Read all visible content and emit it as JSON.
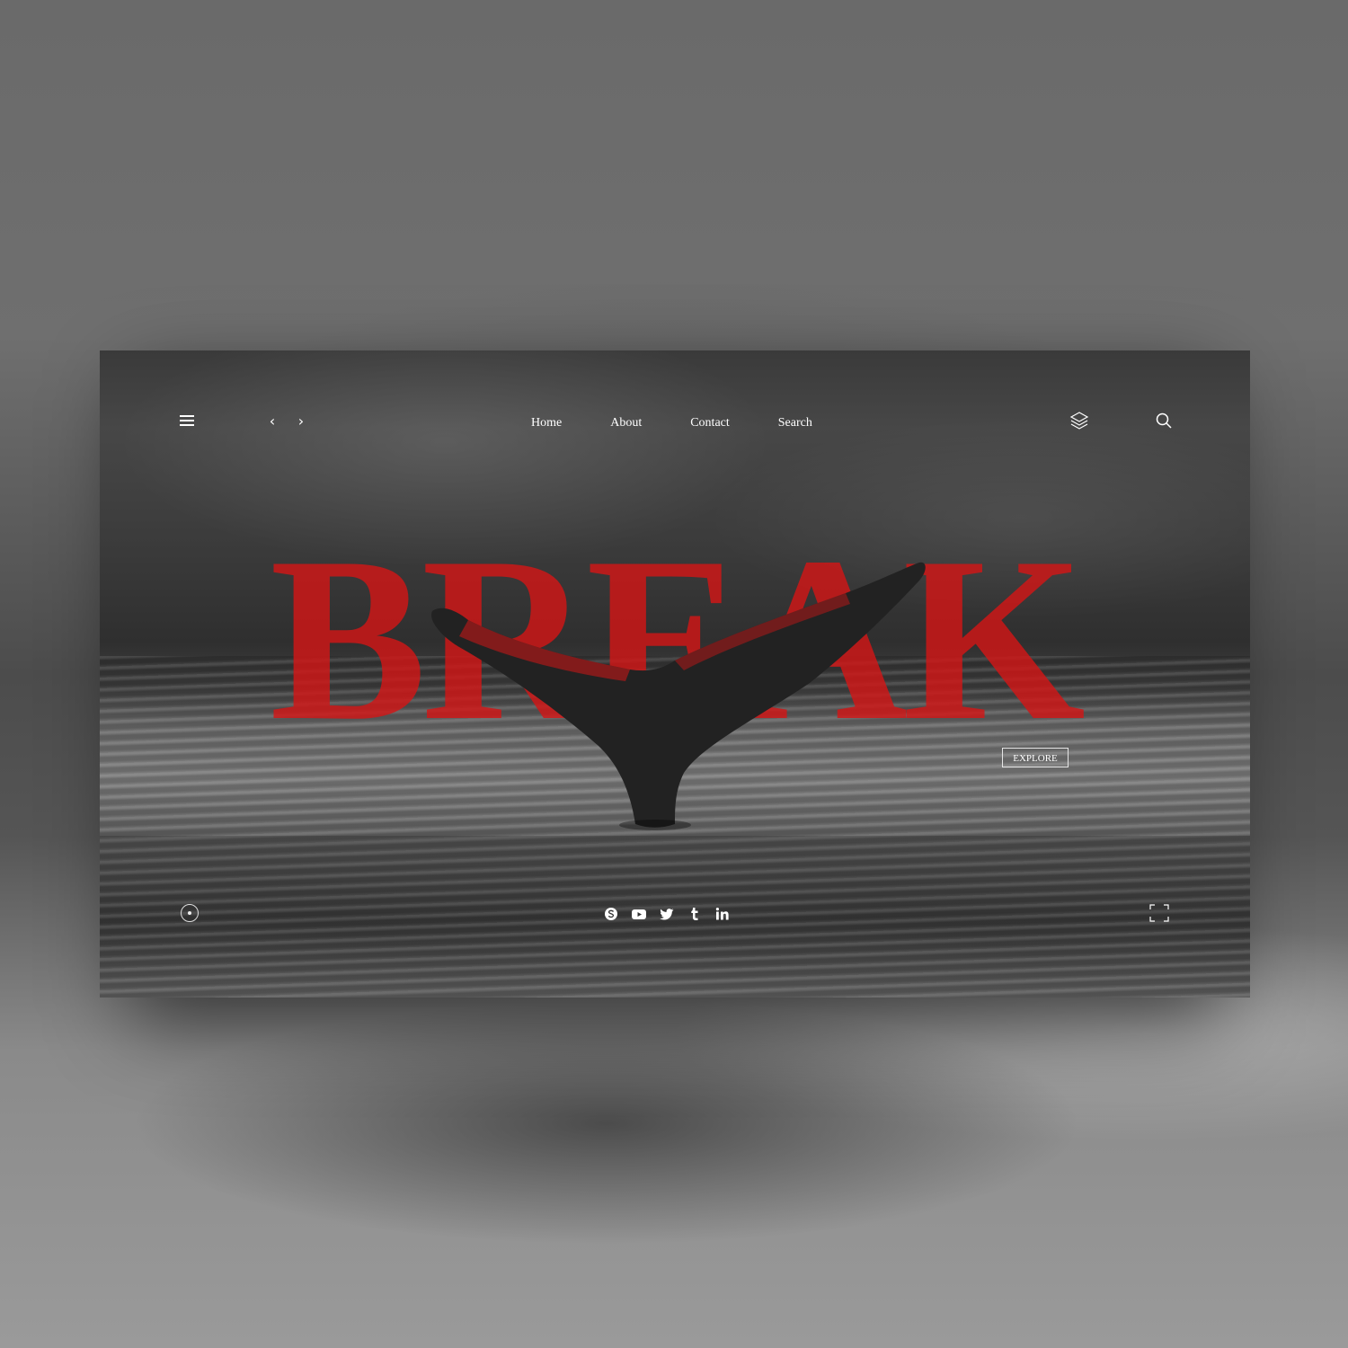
{
  "nav": {
    "items": [
      {
        "label": "Home"
      },
      {
        "label": "About"
      },
      {
        "label": "Contact"
      },
      {
        "label": "Search"
      }
    ]
  },
  "hero": {
    "title": "BREAK",
    "explore_label": "EXPLORE",
    "title_color": "#d21616"
  },
  "icons": {
    "menu": "hamburger-menu-icon",
    "prev": "chevron-left-icon",
    "next": "chevron-right-icon",
    "layers": "layers-icon",
    "search": "search-icon",
    "scroll": "scroll-dot-icon",
    "fullscreen": "fullscreen-icon",
    "social": [
      "skype-icon",
      "youtube-icon",
      "twitter-icon",
      "tumblr-icon",
      "linkedin-icon"
    ]
  },
  "glyphs": {
    "prev": "‹",
    "next": "›"
  }
}
